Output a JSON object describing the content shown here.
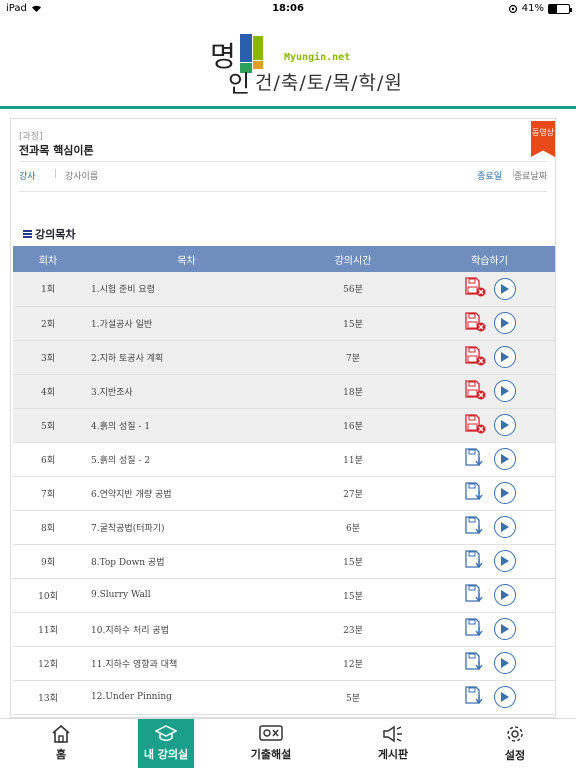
{
  "status_bar": {
    "carrier": "iPad",
    "time": "18:06",
    "battery": "41%",
    "battery_level": 0.41
  },
  "logo": {
    "hanja": "명인",
    "url_text": "Myungin.net",
    "name": "건/축/토/목/학/원"
  },
  "course": {
    "tag": "[과정]",
    "name": "전과목 핵심이론",
    "badge": "동영상"
  },
  "info": {
    "teacher_label": "강사",
    "teacher_name": "강사이름",
    "end_label": "종료일",
    "end_date": "종료날짜"
  },
  "toc": {
    "heading": "강의목차",
    "columns": [
      "회차",
      "목차",
      "강의시간",
      "학습하기"
    ],
    "rows": [
      {
        "round": "1회",
        "title": "1.시험 준비 요령",
        "time": "56분",
        "file_icon": "file-blocked-icon"
      },
      {
        "round": "2회",
        "title": "1.가설공사 일반",
        "time": "15분",
        "file_icon": "file-blocked-icon"
      },
      {
        "round": "3회",
        "title": "2.지하 토공사 계획",
        "time": "7분",
        "file_icon": "file-blocked-icon"
      },
      {
        "round": "4회",
        "title": "3.지반조사",
        "time": "18분",
        "file_icon": "file-blocked-icon"
      },
      {
        "round": "5회",
        "title": "4.흙의 성질 - 1",
        "time": "16분",
        "file_icon": "file-blocked-icon"
      },
      {
        "round": "6회",
        "title": "5.흙의 성질 - 2",
        "time": "11분",
        "file_icon": "download-icon"
      },
      {
        "round": "7회",
        "title": "6.연약지반 개량 공법",
        "time": "27분",
        "file_icon": "download-icon"
      },
      {
        "round": "8회",
        "title": "7.굴착공법(터파기)",
        "time": "6분",
        "file_icon": "download-icon"
      },
      {
        "round": "9회",
        "title": "8.Top Down 공법",
        "time": "15분",
        "file_icon": "download-icon"
      },
      {
        "round": "10회",
        "title": "9.Slurry Wall",
        "time": "15분",
        "file_icon": "download-icon"
      },
      {
        "round": "11회",
        "title": "10.지하수 처리 공법",
        "time": "23분",
        "file_icon": "download-icon"
      },
      {
        "round": "12회",
        "title": "11.지하수 영향과 대책",
        "time": "12분",
        "file_icon": "download-icon"
      },
      {
        "round": "13회",
        "title": "12.Under Pinning",
        "time": "5분",
        "file_icon": "download-icon"
      }
    ]
  },
  "tabs": [
    {
      "label": "홈",
      "icon": "home-icon"
    },
    {
      "label": "내 강의실",
      "icon": "graduation-cap-icon",
      "active": true
    },
    {
      "label": "기출해설",
      "icon": "quiz-icon"
    },
    {
      "label": "게시판",
      "icon": "megaphone-icon"
    },
    {
      "label": "설정",
      "icon": "gear-icon"
    }
  ],
  "colors": {
    "accent": "#1aa08a",
    "header": "#6f8ebe",
    "badge": "#e84a1a",
    "link": "#2a6fb0"
  }
}
